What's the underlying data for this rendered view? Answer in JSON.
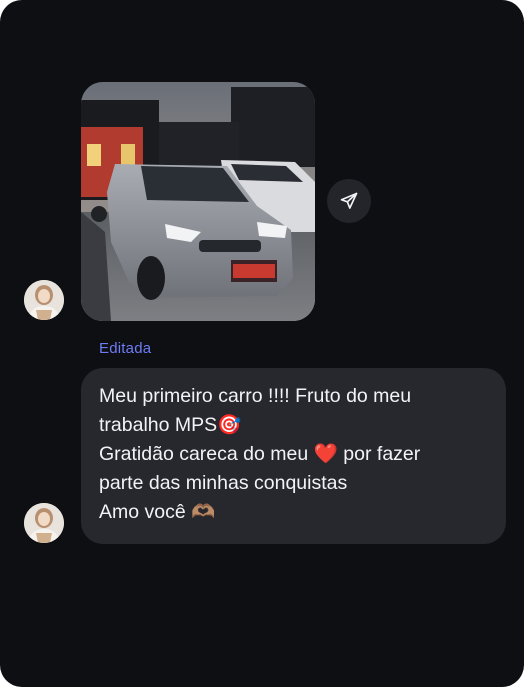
{
  "message": {
    "edited_label": "Editada",
    "photo_alt": "Car photo",
    "text_lines": [
      "Meu primeiro carro !!!!  Fruto do meu",
      "trabalho MPS🎯",
      "Gratidão careca do meu ❤️  por fazer",
      "parte das minhas conquistas",
      "Amo você 🫶🏽"
    ]
  },
  "icons": {
    "share": "paper-plane-icon",
    "avatar": "user-avatar"
  },
  "colors": {
    "background": "#0e0f13",
    "bubble": "#26282e",
    "edited_label": "#6e7cf5",
    "share_button": "#23252b",
    "text": "#f3f3f5"
  }
}
